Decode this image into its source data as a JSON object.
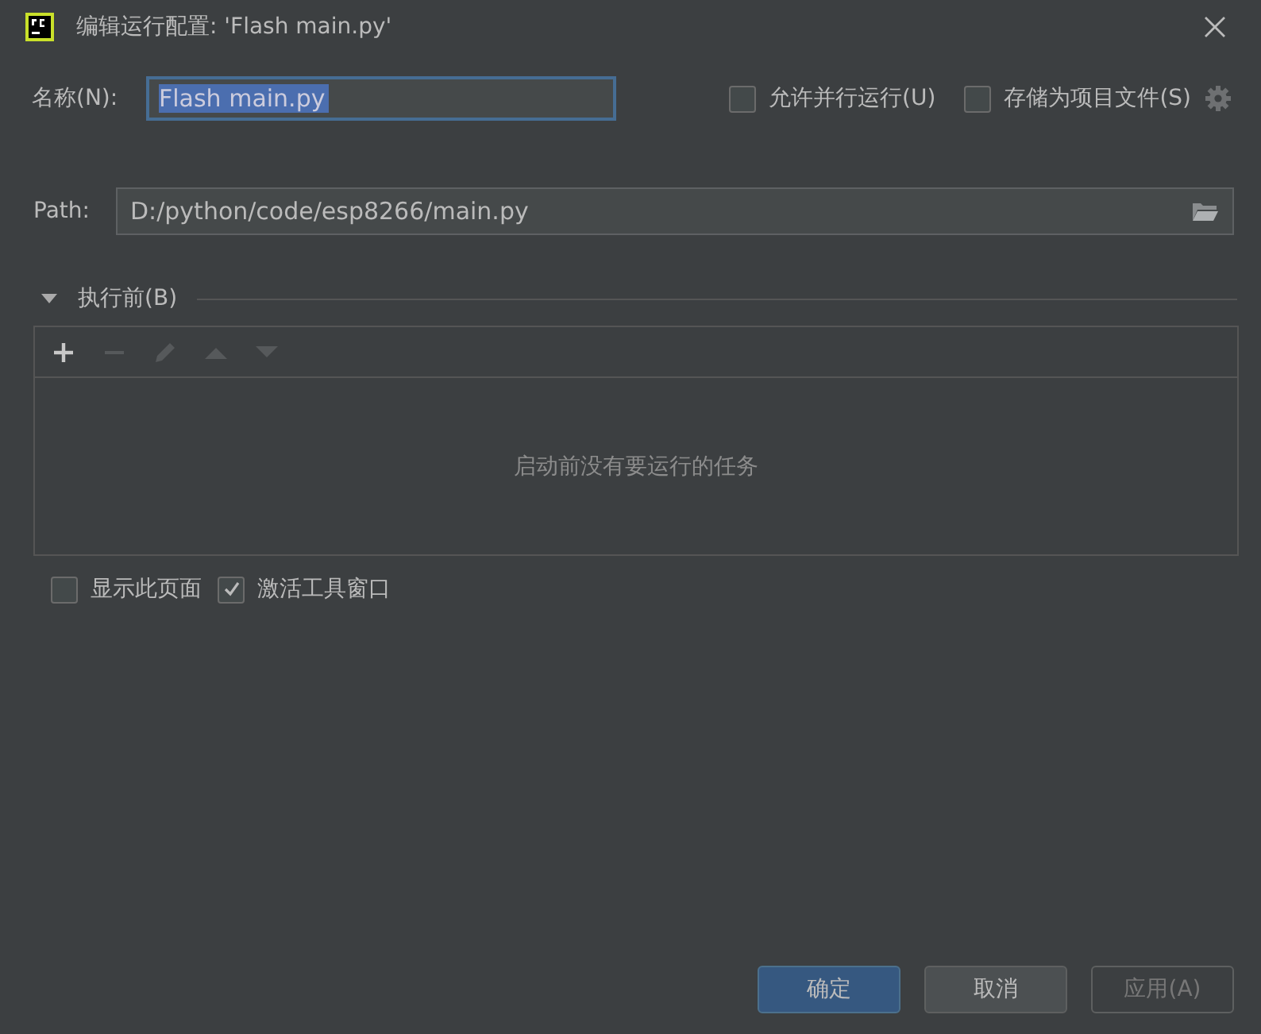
{
  "window": {
    "title": "编辑运行配置: 'Flash main.py'"
  },
  "name_field": {
    "label": "名称(N):",
    "value": "Flash main.py",
    "selected": true
  },
  "options": [
    {
      "label": "允许并行运行(U)",
      "checked": false
    },
    {
      "label": "存储为项目文件(S)",
      "checked": false
    }
  ],
  "path_field": {
    "label": "Path:",
    "value": "D:/python/code/esp8266/main.py"
  },
  "before_launch": {
    "title": "执行前(B)",
    "expanded": true,
    "toolbar": [
      {
        "kind": "add",
        "disabled": false
      },
      {
        "kind": "remove",
        "disabled": true
      },
      {
        "kind": "edit",
        "disabled": true
      },
      {
        "kind": "up",
        "disabled": true
      },
      {
        "kind": "down",
        "disabled": true
      }
    ],
    "empty_text": "启动前没有要运行的任务"
  },
  "bottom_options": [
    {
      "label": "显示此页面",
      "checked": false
    },
    {
      "label": "激活工具窗口",
      "checked": true
    }
  ],
  "buttons": [
    {
      "label": "确定",
      "kind": "primary",
      "disabled": false
    },
    {
      "label": "取消",
      "kind": "normal",
      "disabled": false
    },
    {
      "label": "应用(A)",
      "kind": "normal",
      "disabled": true
    }
  ]
}
